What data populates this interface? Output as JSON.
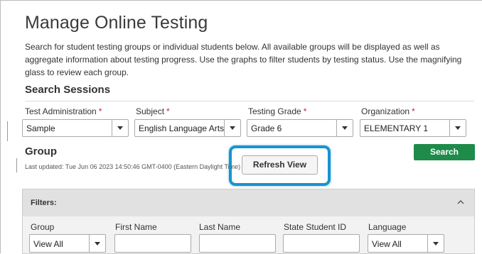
{
  "page": {
    "title": "Manage Online Testing",
    "intro": "Search for student testing groups or individual students below. All available groups will be displayed as well as aggregate information about testing progress. Use the graphs to filter students by testing status. Use the magnifying glass to review each group."
  },
  "search_sessions": {
    "title": "Search Sessions",
    "required_mark": "*",
    "fields": [
      {
        "label": "Test Administration",
        "value": "Sample"
      },
      {
        "label": "Subject",
        "value": "English Language Arts"
      },
      {
        "label": "Testing Grade",
        "value": "Grade 6"
      },
      {
        "label": "Organization",
        "value": "ELEMENTARY 1"
      }
    ],
    "search_label": "Search"
  },
  "group": {
    "title": "Group",
    "last_updated": "Last updated: Tue Jun 06 2023 14:50:46 GMT-0400 (Eastern Daylight Time)",
    "refresh_label": "Refresh View",
    "highlight_color": "#1a93cf"
  },
  "filters": {
    "title": "Filters:",
    "fields": [
      {
        "label": "Group",
        "value": "View All",
        "type": "select"
      },
      {
        "label": "First Name",
        "value": "",
        "type": "text"
      },
      {
        "label": "Last Name",
        "value": "",
        "type": "text"
      },
      {
        "label": "State Student ID",
        "value": "",
        "type": "text"
      },
      {
        "label": "Language",
        "value": "View All",
        "type": "select"
      }
    ]
  },
  "colors": {
    "search_button": "#1e8b4a",
    "required": "#c4262e"
  }
}
